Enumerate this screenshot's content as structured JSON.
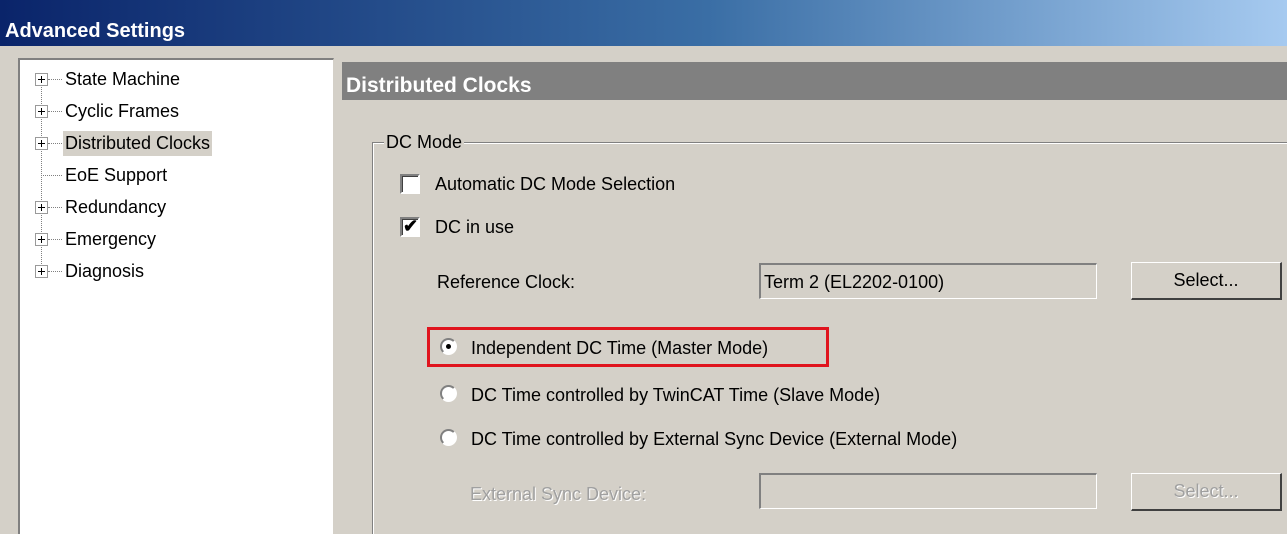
{
  "window": {
    "title": "Advanced Settings"
  },
  "tree": {
    "items": [
      {
        "label": "State Machine",
        "expandable": true
      },
      {
        "label": "Cyclic Frames",
        "expandable": true
      },
      {
        "label": "Distributed Clocks",
        "expandable": true,
        "selected": true
      },
      {
        "label": "EoE Support",
        "expandable": false
      },
      {
        "label": "Redundancy",
        "expandable": true
      },
      {
        "label": "Emergency",
        "expandable": true
      },
      {
        "label": "Diagnosis",
        "expandable": true
      }
    ]
  },
  "panel": {
    "title": "Distributed Clocks"
  },
  "dc_mode": {
    "group_label": "DC Mode",
    "auto_selection": {
      "label": "Automatic DC Mode Selection",
      "checked": false
    },
    "dc_in_use": {
      "label": "DC in use",
      "checked": true
    },
    "reference_clock": {
      "label": "Reference Clock:",
      "value": "Term 2 (EL2202-0100)",
      "button": "Select..."
    },
    "modes": [
      {
        "label": "Independent DC Time (Master Mode)",
        "selected": true
      },
      {
        "label": "DC Time controlled by TwinCAT Time (Slave Mode)",
        "selected": false
      },
      {
        "label": "DC Time controlled by External Sync Device (External Mode)",
        "selected": false
      }
    ],
    "external_sync": {
      "label": "External Sync Device:",
      "value": "",
      "button": "Select..."
    }
  },
  "colors": {
    "highlight": "#e0141e",
    "title_gradient_start": "#0a246a",
    "title_gradient_end": "#a6caf0"
  }
}
